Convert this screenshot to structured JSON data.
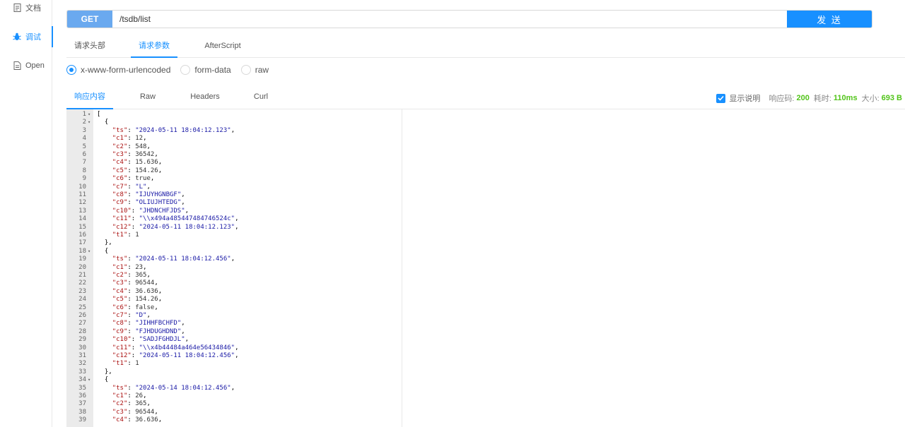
{
  "sidebar": {
    "items": [
      {
        "label": "文档",
        "icon": "document-icon"
      },
      {
        "label": "调试",
        "icon": "bug-icon"
      },
      {
        "label": "Open",
        "icon": "file-icon"
      }
    ]
  },
  "request": {
    "method": "GET",
    "url": "/tsdb/list",
    "send_label": "发 送"
  },
  "req_tabs": [
    "请求头部",
    "请求参数",
    "AfterScript"
  ],
  "body_types": [
    "x-www-form-urlencoded",
    "form-data",
    "raw"
  ],
  "resp_tabs": [
    "响应内容",
    "Raw",
    "Headers",
    "Curl"
  ],
  "resp_info": {
    "show_desc": "显示说明",
    "code_label": "响应码:",
    "code": "200",
    "time_label": "耗时:",
    "time": "110ms",
    "size_label": "大小:",
    "size": "693 B"
  },
  "code": [
    {
      "n": "1",
      "f": true,
      "t": "["
    },
    {
      "n": "2",
      "f": true,
      "t": "  {"
    },
    {
      "n": "3",
      "k": "ts",
      "v": "\"2024-05-11 18:04:12.123\"",
      "ty": "s"
    },
    {
      "n": "4",
      "k": "c1",
      "v": "12",
      "ty": "n"
    },
    {
      "n": "5",
      "k": "c2",
      "v": "548",
      "ty": "n"
    },
    {
      "n": "6",
      "k": "c3",
      "v": "36542",
      "ty": "n"
    },
    {
      "n": "7",
      "k": "c4",
      "v": "15.636",
      "ty": "n"
    },
    {
      "n": "8",
      "k": "c5",
      "v": "154.26",
      "ty": "n"
    },
    {
      "n": "9",
      "k": "c6",
      "v": "true",
      "ty": "n"
    },
    {
      "n": "10",
      "k": "c7",
      "v": "\"L\"",
      "ty": "s"
    },
    {
      "n": "11",
      "k": "c8",
      "v": "\"IJUYHGNBGF\"",
      "ty": "s"
    },
    {
      "n": "12",
      "k": "c9",
      "v": "\"OLIUJHTEDG\"",
      "ty": "s"
    },
    {
      "n": "13",
      "k": "c10",
      "v": "\"JHDNCHFJDS\"",
      "ty": "s"
    },
    {
      "n": "14",
      "k": "c11",
      "v": "\"\\\\x494a485447484746524c\"",
      "ty": "s"
    },
    {
      "n": "15",
      "k": "c12",
      "v": "\"2024-05-11 18:04:12.123\"",
      "ty": "s"
    },
    {
      "n": "16",
      "k": "t1",
      "v": "1",
      "ty": "n",
      "last": true
    },
    {
      "n": "17",
      "t": "  },"
    },
    {
      "n": "18",
      "f": true,
      "t": "  {"
    },
    {
      "n": "19",
      "k": "ts",
      "v": "\"2024-05-11 18:04:12.456\"",
      "ty": "s"
    },
    {
      "n": "20",
      "k": "c1",
      "v": "23",
      "ty": "n"
    },
    {
      "n": "21",
      "k": "c2",
      "v": "365",
      "ty": "n"
    },
    {
      "n": "22",
      "k": "c3",
      "v": "96544",
      "ty": "n"
    },
    {
      "n": "23",
      "k": "c4",
      "v": "36.636",
      "ty": "n"
    },
    {
      "n": "24",
      "k": "c5",
      "v": "154.26",
      "ty": "n"
    },
    {
      "n": "25",
      "k": "c6",
      "v": "false",
      "ty": "n"
    },
    {
      "n": "26",
      "k": "c7",
      "v": "\"D\"",
      "ty": "s"
    },
    {
      "n": "27",
      "k": "c8",
      "v": "\"JIHHFBCHFD\"",
      "ty": "s"
    },
    {
      "n": "28",
      "k": "c9",
      "v": "\"FJHDUGHDND\"",
      "ty": "s"
    },
    {
      "n": "29",
      "k": "c10",
      "v": "\"SADJFGHDJL\"",
      "ty": "s"
    },
    {
      "n": "30",
      "k": "c11",
      "v": "\"\\\\x4b44484a464e56434846\"",
      "ty": "s"
    },
    {
      "n": "31",
      "k": "c12",
      "v": "\"2024-05-11 18:04:12.456\"",
      "ty": "s"
    },
    {
      "n": "32",
      "k": "t1",
      "v": "1",
      "ty": "n",
      "last": true
    },
    {
      "n": "33",
      "t": "  },"
    },
    {
      "n": "34",
      "f": true,
      "t": "  {"
    },
    {
      "n": "35",
      "k": "ts",
      "v": "\"2024-05-14 18:04:12.456\"",
      "ty": "s"
    },
    {
      "n": "36",
      "k": "c1",
      "v": "26",
      "ty": "n"
    },
    {
      "n": "37",
      "k": "c2",
      "v": "365",
      "ty": "n"
    },
    {
      "n": "38",
      "k": "c3",
      "v": "96544",
      "ty": "n"
    },
    {
      "n": "39",
      "k": "c4",
      "v": "36.636",
      "ty": "n"
    }
  ],
  "colors": {
    "accent": "#1890ff",
    "method_bg": "#6aa9ef",
    "success": "#52c41a",
    "json_key": "#a11",
    "json_string": "#1a1aa6"
  }
}
